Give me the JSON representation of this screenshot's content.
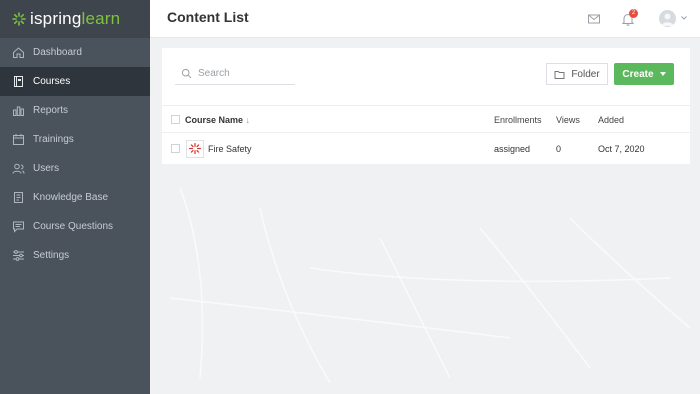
{
  "brand": {
    "name_part1": "ispring",
    "name_part2": "learn",
    "accent_color": "#7fc241"
  },
  "sidebar": {
    "items": [
      {
        "label": "Dashboard",
        "icon": "home-icon",
        "active": false
      },
      {
        "label": "Courses",
        "icon": "book-icon",
        "active": true
      },
      {
        "label": "Reports",
        "icon": "bar-chart-icon",
        "active": false
      },
      {
        "label": "Trainings",
        "icon": "calendar-icon",
        "active": false
      },
      {
        "label": "Users",
        "icon": "users-icon",
        "active": false
      },
      {
        "label": "Knowledge Base",
        "icon": "knowledge-base-icon",
        "active": false
      },
      {
        "label": "Course Questions",
        "icon": "chat-icon",
        "active": false
      },
      {
        "label": "Settings",
        "icon": "sliders-icon",
        "active": false
      }
    ]
  },
  "header": {
    "title": "Content List",
    "notifications_count": "2"
  },
  "toolbar": {
    "search_placeholder": "Search",
    "folder_label": "Folder",
    "create_label": "Create"
  },
  "table": {
    "columns": {
      "name": "Course Name",
      "enrollments": "Enrollments",
      "views": "Views",
      "added": "Added"
    },
    "rows": [
      {
        "name": "Fire Safety",
        "enrollments": "assigned",
        "views": "0",
        "added": "Oct 7, 2020"
      }
    ]
  },
  "colors": {
    "sidebar_bg": "#4a525b",
    "sidebar_active": "#2f353c",
    "create_green": "#5cb85c",
    "badge_red": "#e84c3d"
  }
}
